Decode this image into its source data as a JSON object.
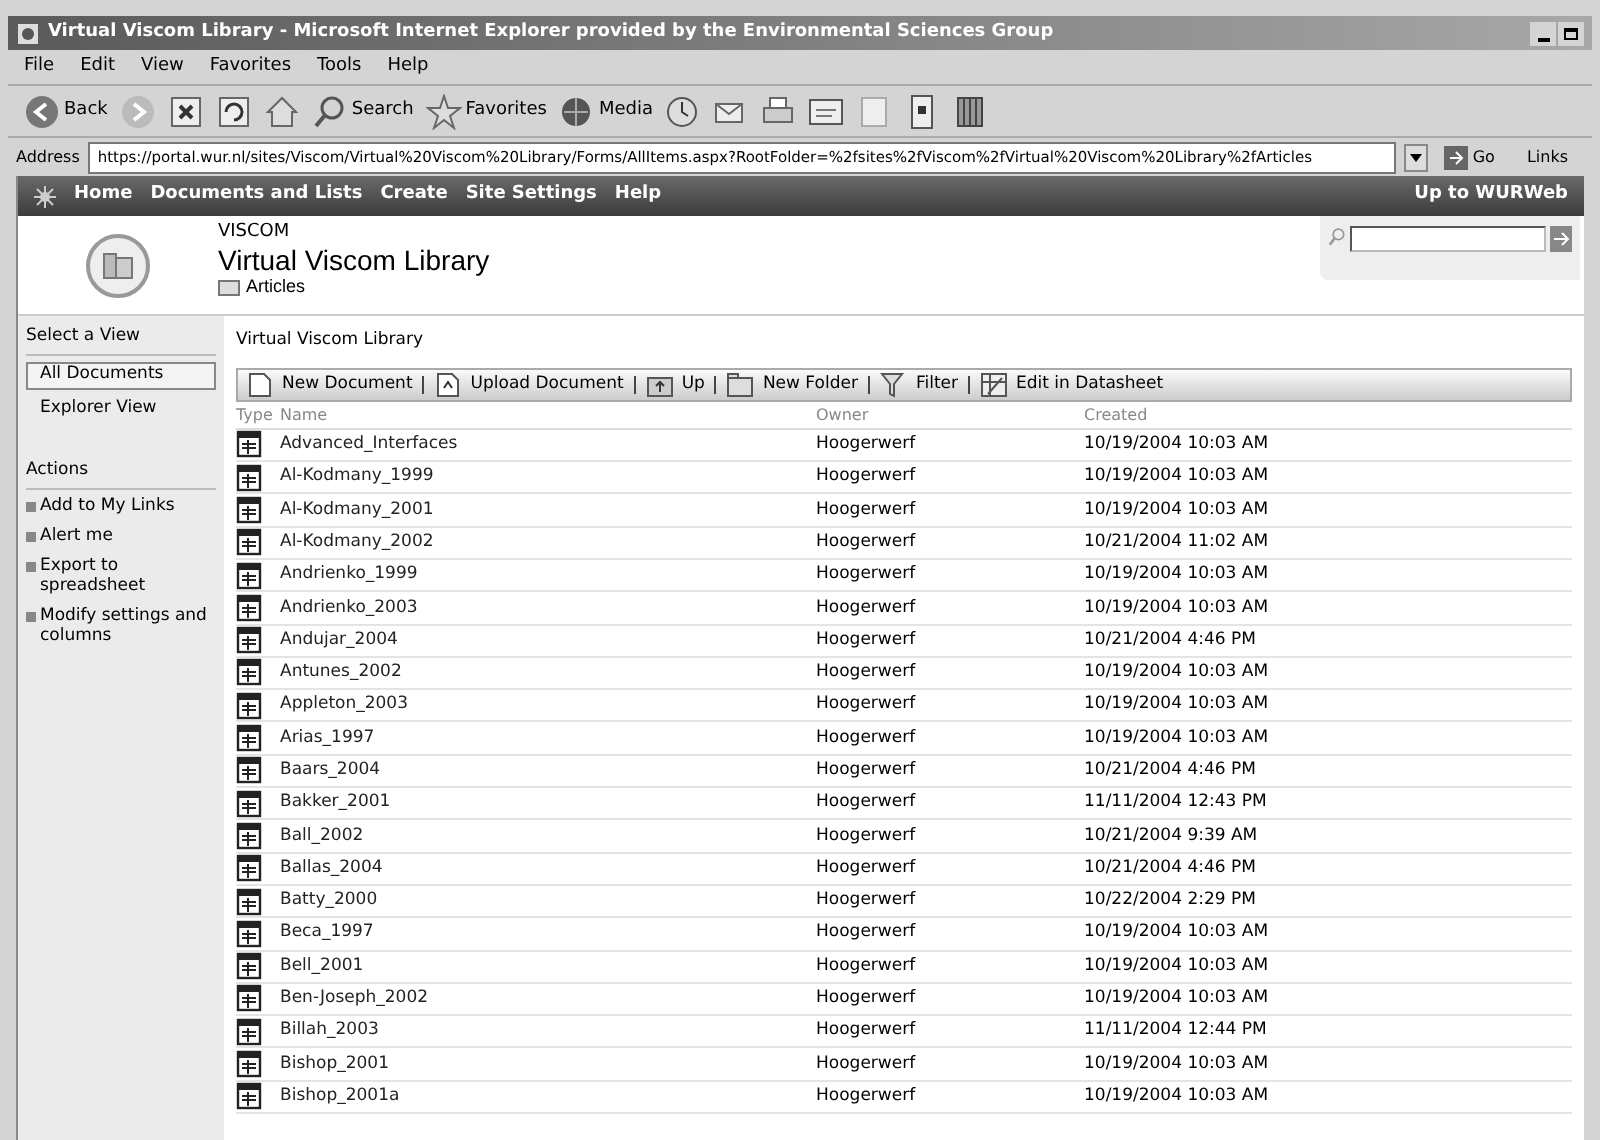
{
  "window": {
    "title": "Virtual Viscom Library - Microsoft Internet Explorer provided by the Environmental Sciences Group"
  },
  "menu": [
    "File",
    "Edit",
    "View",
    "Favorites",
    "Tools",
    "Help"
  ],
  "toolbar": [
    {
      "kind": "back",
      "label": "Back"
    },
    {
      "kind": "forward"
    },
    {
      "kind": "stop"
    },
    {
      "kind": "refresh"
    },
    {
      "kind": "home"
    },
    {
      "kind": "search",
      "label": "Search"
    },
    {
      "kind": "favorites",
      "label": "Favorites"
    },
    {
      "kind": "media",
      "label": "Media"
    },
    {
      "kind": "history"
    },
    {
      "kind": "mail"
    },
    {
      "kind": "print"
    },
    {
      "kind": "edit"
    },
    {
      "kind": "discuss"
    },
    {
      "kind": "messenger"
    },
    {
      "kind": "research"
    }
  ],
  "address": {
    "label": "Address",
    "value": "https://portal.wur.nl/sites/Viscom/Virtual%20Viscom%20Library/Forms/AllItems.aspx?RootFolder=%2fsites%2fViscom%2fVirtual%20Viscom%20Library%2fArticles",
    "go": "Go",
    "links": "Links"
  },
  "site_nav": {
    "items": [
      "Home",
      "Documents and Lists",
      "Create",
      "Site Settings",
      "Help"
    ],
    "right": "Up to WURWeb"
  },
  "header": {
    "site": "VISCOM",
    "title": "Virtual Viscom Library",
    "folder": "Articles"
  },
  "sidebar": {
    "view_heading": "Select a View",
    "views": [
      {
        "label": "All Documents",
        "selected": true
      },
      {
        "label": "Explorer View",
        "selected": false
      }
    ],
    "actions_heading": "Actions",
    "actions": [
      "Add to My Links",
      "Alert me",
      "Export to spreadsheet",
      "Modify settings and columns"
    ]
  },
  "breadcrumb": "Virtual Viscom Library",
  "list_toolbar": [
    {
      "kind": "new",
      "label": "New Document"
    },
    {
      "kind": "upload",
      "label": "Upload Document"
    },
    {
      "kind": "up",
      "label": "Up"
    },
    {
      "kind": "folder",
      "label": "New Folder"
    },
    {
      "kind": "filter",
      "label": "Filter"
    },
    {
      "kind": "datasheet",
      "label": "Edit in Datasheet"
    }
  ],
  "table": {
    "columns": [
      "Type",
      "Name",
      "Owner",
      "Created"
    ],
    "rows": [
      {
        "name": "Advanced_Interfaces",
        "owner": "Hoogerwerf",
        "created": "10/19/2004 10:03 AM"
      },
      {
        "name": "Al-Kodmany_1999",
        "owner": "Hoogerwerf",
        "created": "10/19/2004 10:03 AM"
      },
      {
        "name": "Al-Kodmany_2001",
        "owner": "Hoogerwerf",
        "created": "10/19/2004 10:03 AM"
      },
      {
        "name": "Al-Kodmany_2002",
        "owner": "Hoogerwerf",
        "created": "10/21/2004 11:02 AM"
      },
      {
        "name": "Andrienko_1999",
        "owner": "Hoogerwerf",
        "created": "10/19/2004 10:03 AM"
      },
      {
        "name": "Andrienko_2003",
        "owner": "Hoogerwerf",
        "created": "10/19/2004 10:03 AM"
      },
      {
        "name": "Andujar_2004",
        "owner": "Hoogerwerf",
        "created": "10/21/2004 4:46 PM"
      },
      {
        "name": "Antunes_2002",
        "owner": "Hoogerwerf",
        "created": "10/19/2004 10:03 AM"
      },
      {
        "name": "Appleton_2003",
        "owner": "Hoogerwerf",
        "created": "10/19/2004 10:03 AM"
      },
      {
        "name": "Arias_1997",
        "owner": "Hoogerwerf",
        "created": "10/19/2004 10:03 AM"
      },
      {
        "name": "Baars_2004",
        "owner": "Hoogerwerf",
        "created": "10/21/2004 4:46 PM"
      },
      {
        "name": "Bakker_2001",
        "owner": "Hoogerwerf",
        "created": "11/11/2004 12:43 PM"
      },
      {
        "name": "Ball_2002",
        "owner": "Hoogerwerf",
        "created": "10/21/2004 9:39 AM"
      },
      {
        "name": "Ballas_2004",
        "owner": "Hoogerwerf",
        "created": "10/21/2004 4:46 PM"
      },
      {
        "name": "Batty_2000",
        "owner": "Hoogerwerf",
        "created": "10/22/2004 2:29 PM"
      },
      {
        "name": "Beca_1997",
        "owner": "Hoogerwerf",
        "created": "10/19/2004 10:03 AM"
      },
      {
        "name": "Bell_2001",
        "owner": "Hoogerwerf",
        "created": "10/19/2004 10:03 AM"
      },
      {
        "name": "Ben-Joseph_2002",
        "owner": "Hoogerwerf",
        "created": "10/19/2004 10:03 AM"
      },
      {
        "name": "Billah_2003",
        "owner": "Hoogerwerf",
        "created": "11/11/2004 12:44 PM"
      },
      {
        "name": "Bishop_2001",
        "owner": "Hoogerwerf",
        "created": "10/19/2004 10:03 AM"
      },
      {
        "name": "Bishop_2001a",
        "owner": "Hoogerwerf",
        "created": "10/19/2004 10:03 AM"
      }
    ]
  }
}
